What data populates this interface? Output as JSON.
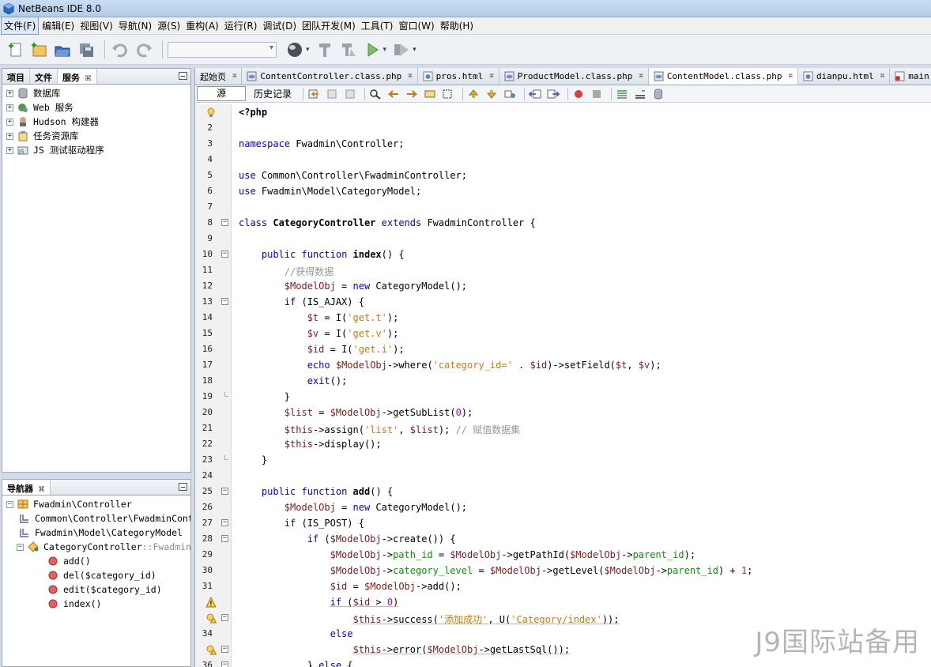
{
  "window": {
    "title": "NetBeans IDE 8.0"
  },
  "menu": [
    {
      "label": "文件(F)"
    },
    {
      "label": "编辑(E)"
    },
    {
      "label": "视图(V)"
    },
    {
      "label": "导航(N)"
    },
    {
      "label": "源(S)"
    },
    {
      "label": "重构(A)"
    },
    {
      "label": "运行(R)"
    },
    {
      "label": "调试(D)"
    },
    {
      "label": "团队开发(M)"
    },
    {
      "label": "工具(T)"
    },
    {
      "label": "窗口(W)"
    },
    {
      "label": "帮助(H)"
    }
  ],
  "services_panel": {
    "tabs": [
      "项目",
      "文件",
      "服务"
    ],
    "active_tab": "服务",
    "items": [
      {
        "label": "数据库",
        "icon": "database-icon"
      },
      {
        "label": "Web 服务",
        "icon": "web-services-icon"
      },
      {
        "label": "Hudson 构建器",
        "icon": "hudson-icon"
      },
      {
        "label": "任务资源库",
        "icon": "task-repository-icon"
      },
      {
        "label": "JS 测试驱动程序",
        "icon": "js-test-driver-icon"
      }
    ]
  },
  "navigator_panel": {
    "tab": "导航器",
    "root": "Fwadmin\\Controller",
    "uses": [
      "Common\\Controller\\FwadminCont",
      "Fwadmin\\Model\\CategoryModel"
    ],
    "class_name": "CategoryController",
    "class_suffix": "::FwadminCo",
    "methods": [
      "add()",
      "del($category_id)",
      "edit($category_id)",
      "index()"
    ]
  },
  "editor": {
    "tabs": [
      {
        "label": "起始页",
        "icon": "start-page-icon"
      },
      {
        "label": "ContentController.class.php",
        "icon": "php-file-icon"
      },
      {
        "label": "pros.html",
        "icon": "html-file-icon"
      },
      {
        "label": "ProductModel.class.php",
        "icon": "php-file-icon"
      },
      {
        "label": "ContentModel.class.php",
        "icon": "php-file-icon"
      },
      {
        "label": "dianpu.html",
        "icon": "html-file-icon"
      },
      {
        "label": "main.html",
        "icon": "html-file-error-icon"
      }
    ],
    "source_label": "源",
    "history_label": "历史记录",
    "code_lines": [
      {
        "n": "1",
        "t": "<?php"
      },
      {
        "n": "2",
        "t": ""
      },
      {
        "n": "3",
        "t": "namespace Fwadmin\\Controller;"
      },
      {
        "n": "4",
        "t": ""
      },
      {
        "n": "5",
        "t": "use Common\\Controller\\FwadminController;"
      },
      {
        "n": "6",
        "t": "use Fwadmin\\Model\\CategoryModel;"
      },
      {
        "n": "7",
        "t": ""
      },
      {
        "n": "8",
        "t": "class CategoryController extends FwadminController {"
      },
      {
        "n": "9",
        "t": ""
      },
      {
        "n": "10",
        "t": "    public function index() {"
      },
      {
        "n": "11",
        "t": "        //获得数据"
      },
      {
        "n": "12",
        "t": "        $ModelObj = new CategoryModel();"
      },
      {
        "n": "13",
        "t": "        if (IS_AJAX) {"
      },
      {
        "n": "14",
        "t": "            $t = I('get.t');"
      },
      {
        "n": "15",
        "t": "            $v = I('get.v');"
      },
      {
        "n": "16",
        "t": "            $id = I('get.i');"
      },
      {
        "n": "17",
        "t": "            echo $ModelObj->where('category_id=' . $id)->setField($t, $v);"
      },
      {
        "n": "18",
        "t": "            exit();"
      },
      {
        "n": "19",
        "t": "        }"
      },
      {
        "n": "20",
        "t": "        $list = $ModelObj->getSubList(0);"
      },
      {
        "n": "21",
        "t": "        $this->assign('list', $list); // 赋值数据集"
      },
      {
        "n": "22",
        "t": "        $this->display();"
      },
      {
        "n": "23",
        "t": "    }"
      },
      {
        "n": "24",
        "t": ""
      },
      {
        "n": "25",
        "t": "    public function add() {"
      },
      {
        "n": "26",
        "t": "        $ModelObj = new CategoryModel();"
      },
      {
        "n": "27",
        "t": "        if (IS_POST) {"
      },
      {
        "n": "28",
        "t": "            if ($ModelObj->create()) {"
      },
      {
        "n": "29",
        "t": "                $ModelObj->path_id = $ModelObj->getPathId($ModelObj->parent_id);"
      },
      {
        "n": "30",
        "t": "                $ModelObj->category_level = $ModelObj->getLevel($ModelObj->parent_id) + 1;"
      },
      {
        "n": "31",
        "t": "                $id = $ModelObj->add();"
      },
      {
        "n": "",
        "t": "                if ($id > 0)"
      },
      {
        "n": "",
        "t": "                    $this->success('添加成功', U('Category/index'));"
      },
      {
        "n": "34",
        "t": "                else"
      },
      {
        "n": "",
        "t": "                    $this->error($ModelObj->getLastSql());"
      },
      {
        "n": "36",
        "t": "            } else {"
      }
    ]
  },
  "watermark": "J9国际站备用"
}
